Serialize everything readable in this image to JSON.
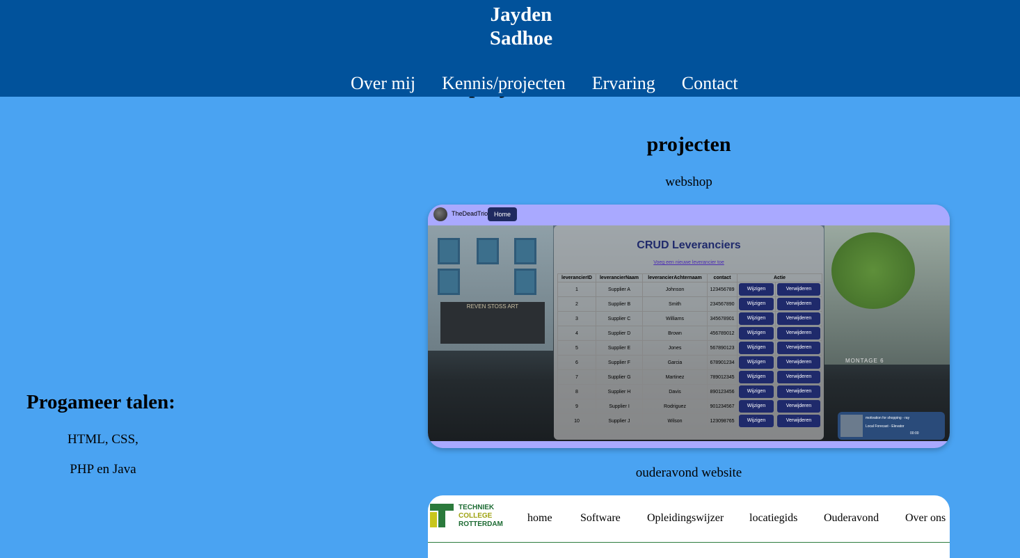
{
  "header": {
    "name_line1": "Jayden",
    "name_line2": "Sadhoe",
    "nav": [
      "Over mij",
      "Kennis/projecten",
      "Ervaring",
      "Contact"
    ]
  },
  "hidden_heading": "projecten",
  "left": {
    "title": "Progameer talen:",
    "line1": "HTML, CSS,",
    "line2": "PHP en Java"
  },
  "right": {
    "title": "projecten",
    "project1_caption": "webshop",
    "project2_caption": "ouderavond website"
  },
  "webshop_screenshot": {
    "site_name": "TheDeadTrio",
    "home_button": "Home",
    "crud_title": "CRUD Leveranciers",
    "add_link": "Voeg een nieuwe leverancier toe",
    "shop_sign": "REVEN STOSS ART",
    "street_sign": "MONTAGE 6",
    "columns": [
      "leverancierID",
      "leverancierNaam",
      "leverancierAchternaam",
      "contact",
      "Actie"
    ],
    "edit_label": "Wijzigen",
    "delete_label": "Verwijderen",
    "rows": [
      {
        "id": "1",
        "name": "Supplier A",
        "last": "Johnson",
        "contact": "123456789"
      },
      {
        "id": "2",
        "name": "Supplier B",
        "last": "Smith",
        "contact": "234567890"
      },
      {
        "id": "3",
        "name": "Supplier C",
        "last": "Williams",
        "contact": "345678901"
      },
      {
        "id": "4",
        "name": "Supplier D",
        "last": "Brown",
        "contact": "456789012"
      },
      {
        "id": "5",
        "name": "Supplier E",
        "last": "Jones",
        "contact": "567890123"
      },
      {
        "id": "6",
        "name": "Supplier F",
        "last": "Garcia",
        "contact": "678901234"
      },
      {
        "id": "7",
        "name": "Supplier G",
        "last": "Martinez",
        "contact": "789012345"
      },
      {
        "id": "8",
        "name": "Supplier H",
        "last": "Davis",
        "contact": "890123456"
      },
      {
        "id": "9",
        "name": "Supplier I",
        "last": "Rodriguez",
        "contact": "901234567"
      },
      {
        "id": "10",
        "name": "Supplier J",
        "last": "Wilson",
        "contact": "123098765"
      }
    ],
    "player": {
      "track": "motivation for shopping - ray",
      "subtitle": "Local Forecast - Elevator",
      "time": "00:00"
    }
  },
  "ouderavond_screenshot": {
    "logo_line1": "TECHNIEK",
    "logo_line2": "COLLEGE",
    "logo_line3": "ROTTERDAM",
    "nav": [
      "home",
      "Software",
      "Opleidingswijzer",
      "locatiegids",
      "Ouderavond",
      "Over ons"
    ]
  },
  "colors": {
    "header_bg": "#01529b",
    "page_bg": "#4aa3f2",
    "screenshot_bar": "#a9a9ff",
    "button_navy": "#1f2a6b"
  }
}
